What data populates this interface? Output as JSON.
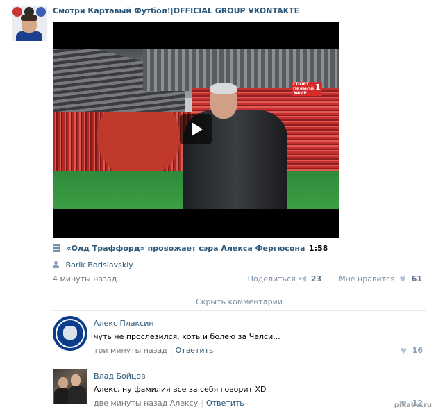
{
  "group": {
    "title": "Смотри Картавый Футбол!|OFFICIAL GROUP VKONTAKTE"
  },
  "video": {
    "channel_logo_text": "СПОРТ",
    "channel_logo_number": "1",
    "channel_logo_sub": "ПРЯМОЙ ЭФИР",
    "title": "«Олд Траффорд» провожает сэра Алекса Фергюсона",
    "duration": "1:58"
  },
  "post": {
    "author": "Borik Borislavskiy",
    "time": "4 минуты назад",
    "share_label": "Поделиться",
    "share_count": "23",
    "like_label": "Мне нравится",
    "like_count": "61"
  },
  "hide_comments_label": "Скрыть комментарии",
  "comments": [
    {
      "author": "Алекс Плаксин",
      "text": "чуть не прослезился, хоть и болею за Челси...",
      "time": "три минуты назад",
      "reply_to": "",
      "reply_label": "Ответить",
      "likes": "16"
    },
    {
      "author": "Влад Бойцов",
      "text": "Алекс, ну фамилия все за себя говорит XD",
      "time": "две минуты назад",
      "reply_to": "Алексу",
      "reply_label": "Ответить",
      "likes": "12"
    }
  ],
  "watermark": "pikabu.ru",
  "colors": {
    "link": "#2b587a",
    "muted": "#777777",
    "divider": "#e2e8ee"
  }
}
